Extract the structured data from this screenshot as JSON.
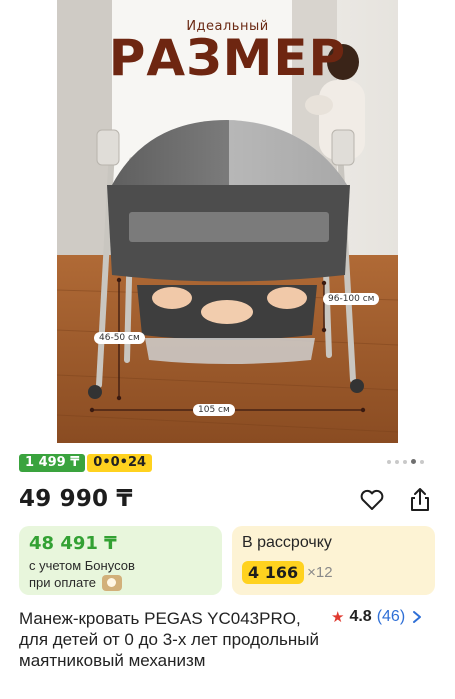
{
  "hero": {
    "subtitle": "Идеальный",
    "title": "РАЗМЕР",
    "dimensions": {
      "height": "96-100 см",
      "depth": "46-50 см",
      "length": "105 см"
    },
    "carousel": {
      "total": 5,
      "active_index": 3
    }
  },
  "badges": {
    "price_badge": "1 499 ₸",
    "installment_badge": "0•0•24"
  },
  "product": {
    "price": "49 990 ₸",
    "title": "Манеж-кровать PEGAS YC043PRO, для детей от 0 до 3-х лет продольный маятниковый механизм",
    "rating": "4.8",
    "reviews": "(46)"
  },
  "bonus_card": {
    "amount": "48 491 ₸",
    "line1": "с учетом Бонусов",
    "line2": "при оплате"
  },
  "installment_card": {
    "title": "В рассрочку",
    "monthly": "4 166",
    "multiplier": "×12"
  },
  "colors": {
    "brand_green": "#3aa33e",
    "brand_yellow": "#ffd21f",
    "rating_star": "#e03a30",
    "link_blue": "#2f6fd6"
  },
  "icons": [
    "heart-icon",
    "share-icon",
    "star-icon",
    "chevron-right-icon",
    "bonus-coin-icon"
  ]
}
